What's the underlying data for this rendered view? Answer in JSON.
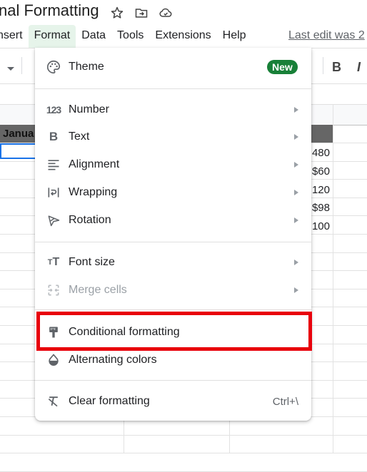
{
  "document": {
    "title": "nal Formatting",
    "icons": [
      "star-icon",
      "move-to-folder-icon",
      "cloud-saved-icon"
    ]
  },
  "menubar": {
    "items": [
      "nsert",
      "Format",
      "Data",
      "Tools",
      "Extensions",
      "Help"
    ],
    "active": "Format",
    "last_edit": "Last edit was 2"
  },
  "toolbar": {
    "bold_label": "B",
    "italic_label": "I"
  },
  "sheet": {
    "header_cell": "Janua",
    "values": [
      "480",
      "$60",
      "120",
      "$98",
      "100"
    ]
  },
  "format_menu": {
    "items": [
      {
        "label": "Theme",
        "icon": "palette-icon",
        "badge": "New"
      },
      {
        "label": "Number",
        "icon": "number-123-icon",
        "submenu": true
      },
      {
        "label": "Text",
        "icon": "bold-icon",
        "submenu": true
      },
      {
        "label": "Alignment",
        "icon": "align-left-icon",
        "submenu": true
      },
      {
        "label": "Wrapping",
        "icon": "wrap-text-icon",
        "submenu": true
      },
      {
        "label": "Rotation",
        "icon": "text-rotation-icon",
        "submenu": true
      },
      {
        "label": "Font size",
        "icon": "font-size-icon",
        "submenu": true
      },
      {
        "label": "Merge cells",
        "icon": "merge-cells-icon",
        "submenu": true,
        "disabled": true
      },
      {
        "label": "Conditional formatting",
        "icon": "paint-roller-icon",
        "highlighted": true
      },
      {
        "label": "Alternating colors",
        "icon": "color-fill-drop-icon"
      },
      {
        "label": "Clear formatting",
        "icon": "clear-format-icon",
        "shortcut": "Ctrl+\\"
      }
    ]
  },
  "colors": {
    "accent_green": "#188038",
    "active_menu_bg": "#e6f4ea",
    "highlight_red": "#e8000b",
    "selection_blue": "#1a73e8"
  }
}
